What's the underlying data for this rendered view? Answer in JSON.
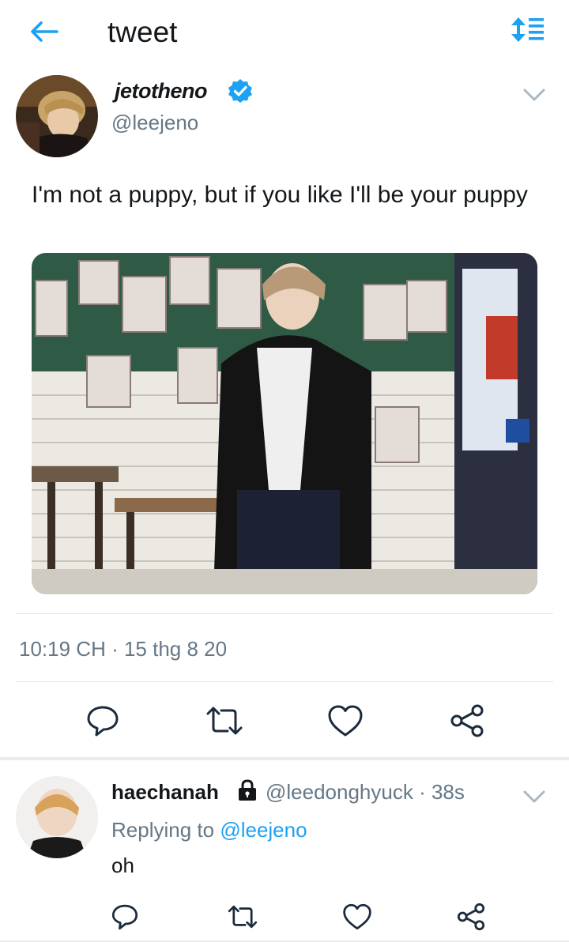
{
  "header": {
    "title": "tweet",
    "back_icon": "arrow-left-icon",
    "sort_icon": "sort-lines-icon",
    "accent": "#1da1f2"
  },
  "tweet": {
    "display_name": "jetotheno",
    "verified": true,
    "handle": "@leejeno",
    "text": "I'm not a puppy, but if you like I'll be your puppy",
    "timestamp": "10:19 CH · 15 thg 8 20",
    "actions": [
      "reply-icon",
      "retweet-icon",
      "like-icon",
      "share-icon"
    ]
  },
  "reply": {
    "display_name": "haechanah",
    "protected": true,
    "handle_time": "@leedonghyuck · 38s",
    "replying_prefix": "Replying to ",
    "replying_to": "@leejeno",
    "text": "oh",
    "actions": [
      "reply-icon",
      "retweet-icon",
      "like-icon",
      "share-icon"
    ]
  },
  "colors": {
    "text": "#14171a",
    "secondary": "#657786",
    "accent": "#1da1f2",
    "divider": "#e1e8ed"
  }
}
